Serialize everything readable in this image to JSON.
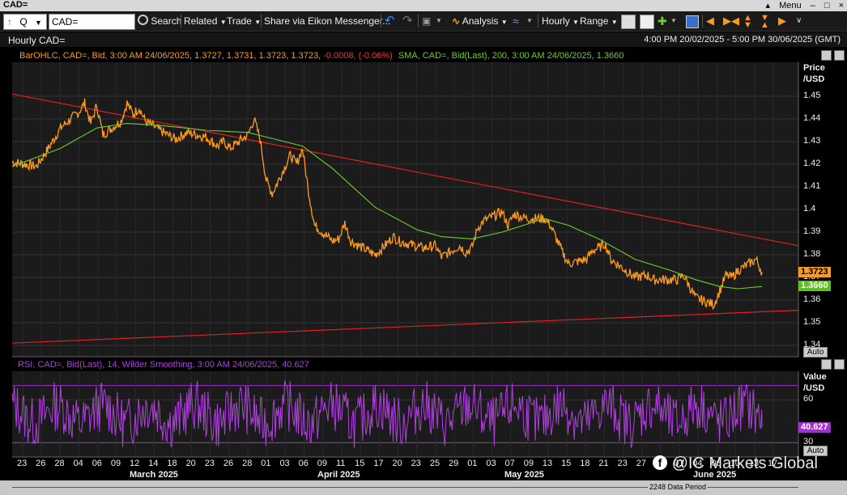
{
  "window": {
    "title": "CAD=",
    "menu_label": "Menu",
    "controls": [
      "–",
      "□",
      "×"
    ]
  },
  "toolbar": {
    "ric_input": "CAD=",
    "search_label": "Search",
    "related_label": "Related",
    "trade_label": "Trade",
    "share_label": "Share via Eikon Messenger...",
    "analysis_label": "Analysis",
    "interval_label": "Hourly",
    "range_label": "Range"
  },
  "header": {
    "title": "Hourly CAD=",
    "date_range": "4:00 PM 20/02/2025 - 5:00 PM 30/06/2025 (GMT)"
  },
  "price_legend": {
    "bar_label": "BarOHLC, CAD=, Bid, 3:00 AM 24/06/2025, 1.3727, 1.3731, 1.3723, 1.3723,",
    "bar_change": "-0.0008, (-0.06%)",
    "sma_label": "SMA, CAD=, Bid(Last), 200, 3:00 AM 24/06/2025, 1.3660"
  },
  "rsi_legend": "RSI, CAD=, Bid(Last), 14, Wilder Smoothing, 3:00 AM 24/06/2025, 40.627",
  "price_axis": {
    "title_line1": "Price",
    "title_line2": "/USD",
    "ticks": [
      "1.45",
      "1.44",
      "1.43",
      "1.42",
      "1.41",
      "1.4",
      "1.39",
      "1.38",
      "1.37",
      "1.36",
      "1.35",
      "1.34"
    ],
    "last_price": "1.3723",
    "sma_value": "1.3660",
    "auto_label": "Auto"
  },
  "rsi_axis": {
    "title_line1": "Value",
    "title_line2": "/USD",
    "ticks": [
      "60",
      "30"
    ],
    "last_value": "40.627",
    "auto_label": "Auto"
  },
  "x_axis": {
    "day_labels": [
      "23",
      "26",
      "28",
      "04",
      "06",
      "09",
      "12",
      "14",
      "18",
      "20",
      "23",
      "26",
      "28",
      "01",
      "03",
      "06",
      "09",
      "11",
      "15",
      "17",
      "20",
      "23",
      "25",
      "29",
      "01",
      "03",
      "07",
      "09",
      "13",
      "15",
      "18",
      "21",
      "23",
      "27",
      "29",
      "01",
      "04",
      "06",
      "10",
      "13",
      "17"
    ],
    "month_labels": [
      "March 2025",
      "April 2025",
      "May 2025",
      "June 2025"
    ]
  },
  "footer": {
    "data_period": "2248 Data Period"
  },
  "watermark": "@IC Markets Global",
  "colors": {
    "price_line": "#ff9a1e",
    "sma_line": "#6ccf2a",
    "trend_line": "#e02020",
    "rsi_line": "#b040e0",
    "rsi_band": "#a030d0",
    "last_price_badge": "#ff9a1e",
    "sma_badge": "#5cc020",
    "rsi_badge": "#a030d0"
  },
  "chart_data": {
    "type": "line",
    "title": "Hourly CAD=",
    "ylabel": "Price /USD",
    "ylim": [
      1.335,
      1.465
    ],
    "price_path": [
      [
        "20/02/2025",
        1.421
      ],
      [
        "24/02/2025",
        1.419
      ],
      [
        "26/02/2025",
        1.427
      ],
      [
        "28/02/2025",
        1.436
      ],
      [
        "03/03/2025",
        1.443
      ],
      [
        "04/03/2025",
        1.447
      ],
      [
        "05/03/2025",
        1.438
      ],
      [
        "06/03/2025",
        1.446
      ],
      [
        "07/03/2025",
        1.433
      ],
      [
        "10/03/2025",
        1.439
      ],
      [
        "11/03/2025",
        1.447
      ],
      [
        "12/03/2025",
        1.442
      ],
      [
        "13/03/2025",
        1.445
      ],
      [
        "14/03/2025",
        1.439
      ],
      [
        "17/03/2025",
        1.434
      ],
      [
        "19/03/2025",
        1.431
      ],
      [
        "21/03/2025",
        1.434
      ],
      [
        "24/03/2025",
        1.432
      ],
      [
        "26/03/2025",
        1.428
      ],
      [
        "27/03/2025",
        1.43
      ],
      [
        "28/03/2025",
        1.427
      ],
      [
        "31/03/2025",
        1.433
      ],
      [
        "01/04/2025",
        1.44
      ],
      [
        "02/04/2025",
        1.431
      ],
      [
        "03/04/2025",
        1.413
      ],
      [
        "04/04/2025",
        1.407
      ],
      [
        "07/04/2025",
        1.424
      ],
      [
        "08/04/2025",
        1.42
      ],
      [
        "09/04/2025",
        1.427
      ],
      [
        "10/04/2025",
        1.408
      ],
      [
        "11/04/2025",
        1.393
      ],
      [
        "14/04/2025",
        1.386
      ],
      [
        "15/04/2025",
        1.387
      ],
      [
        "16/04/2025",
        1.394
      ],
      [
        "17/04/2025",
        1.386
      ],
      [
        "21/04/2025",
        1.38
      ],
      [
        "23/04/2025",
        1.385
      ],
      [
        "24/04/2025",
        1.388
      ],
      [
        "25/04/2025",
        1.386
      ],
      [
        "29/04/2025",
        1.383
      ],
      [
        "01/05/2025",
        1.384
      ],
      [
        "02/05/2025",
        1.379
      ],
      [
        "05/05/2025",
        1.384
      ],
      [
        "06/05/2025",
        1.381
      ],
      [
        "07/05/2025",
        1.383
      ],
      [
        "08/05/2025",
        1.392
      ],
      [
        "09/05/2025",
        1.395
      ],
      [
        "12/05/2025",
        1.399
      ],
      [
        "13/05/2025",
        1.393
      ],
      [
        "14/05/2025",
        1.398
      ],
      [
        "16/05/2025",
        1.396
      ],
      [
        "19/05/2025",
        1.396
      ],
      [
        "20/05/2025",
        1.393
      ],
      [
        "21/05/2025",
        1.387
      ],
      [
        "22/05/2025",
        1.381
      ],
      [
        "23/05/2025",
        1.376
      ],
      [
        "26/05/2025",
        1.378
      ],
      [
        "27/05/2025",
        1.382
      ],
      [
        "28/05/2025",
        1.383
      ],
      [
        "29/05/2025",
        1.385
      ],
      [
        "30/05/2025",
        1.378
      ],
      [
        "02/06/2025",
        1.372
      ],
      [
        "03/06/2025",
        1.37
      ],
      [
        "05/06/2025",
        1.371
      ],
      [
        "06/06/2025",
        1.369
      ],
      [
        "09/06/2025",
        1.369
      ],
      [
        "10/06/2025",
        1.369
      ],
      [
        "11/06/2025",
        1.371
      ],
      [
        "12/06/2025",
        1.366
      ],
      [
        "13/06/2025",
        1.361
      ],
      [
        "16/06/2025",
        1.358
      ],
      [
        "17/06/2025",
        1.364
      ],
      [
        "18/06/2025",
        1.371
      ],
      [
        "19/06/2025",
        1.37
      ],
      [
        "20/06/2025",
        1.373
      ],
      [
        "23/06/2025",
        1.378
      ],
      [
        "24/06/2025",
        1.3723
      ]
    ],
    "sma_path": [
      [
        "20/02/2025",
        1.419
      ],
      [
        "28/02/2025",
        1.427
      ],
      [
        "06/03/2025",
        1.436
      ],
      [
        "11/03/2025",
        1.438
      ],
      [
        "17/03/2025",
        1.437
      ],
      [
        "24/03/2025",
        1.435
      ],
      [
        "31/03/2025",
        1.434
      ],
      [
        "03/04/2025",
        1.432
      ],
      [
        "09/04/2025",
        1.428
      ],
      [
        "14/04/2025",
        1.418
      ],
      [
        "21/04/2025",
        1.401
      ],
      [
        "28/04/2025",
        1.391
      ],
      [
        "02/05/2025",
        1.388
      ],
      [
        "07/05/2025",
        1.387
      ],
      [
        "12/05/2025",
        1.39
      ],
      [
        "19/05/2025",
        1.396
      ],
      [
        "23/05/2025",
        1.393
      ],
      [
        "28/05/2025",
        1.387
      ],
      [
        "03/06/2025",
        1.378
      ],
      [
        "09/06/2025",
        1.373
      ],
      [
        "13/06/2025",
        1.369
      ],
      [
        "17/06/2025",
        1.366
      ],
      [
        "20/06/2025",
        1.365
      ],
      [
        "24/06/2025",
        1.366
      ]
    ],
    "trendlines": [
      {
        "from": [
          "20/02/2025",
          1.451
        ],
        "to": [
          "30/06/2025",
          1.384
        ]
      },
      {
        "from": [
          "20/02/2025",
          1.341
        ],
        "to": [
          "30/06/2025",
          1.3555
        ]
      }
    ],
    "rsi": {
      "ylim": [
        20,
        80
      ],
      "bands": [
        70,
        30
      ],
      "last": 40.627
    }
  }
}
